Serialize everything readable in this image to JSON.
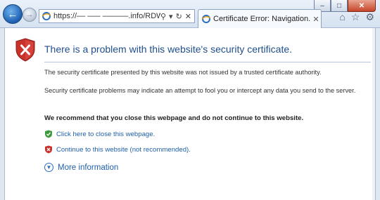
{
  "window": {
    "controls": {
      "minimize": "–",
      "maximize": "□",
      "close": "✕"
    }
  },
  "nav": {
    "back_glyph": "←",
    "forward_glyph": "→"
  },
  "address": {
    "url": "https://–– ––– ––––––.info/RDWeb/",
    "tools": {
      "search": "⚲",
      "dropdown": "▾",
      "refresh": "↻",
      "stop": "✕"
    }
  },
  "tab": {
    "label": "Certificate Error: Navigation...",
    "close": "✕"
  },
  "toolbar_icons": {
    "home": "⌂",
    "favorites": "☆",
    "tools": "⚙"
  },
  "page": {
    "title": "There is a problem with this website's security certificate.",
    "paragraph1": "The security certificate presented by this website was not issued by a trusted certificate authority.",
    "paragraph2": "Security certificate problems may indicate an attempt to fool you or intercept any data you send to the server.",
    "recommendation": "We recommend that you close this webpage and do not continue to this website.",
    "close_link": "Click here to close this webpage.",
    "continue_link": "Continue to this website (not recommended).",
    "more_info": "More information"
  },
  "colors": {
    "accent_link": "#1f5fa8",
    "title": "#1f4e8c",
    "shield_red": "#c9312b",
    "shield_green": "#3c9a3c"
  }
}
